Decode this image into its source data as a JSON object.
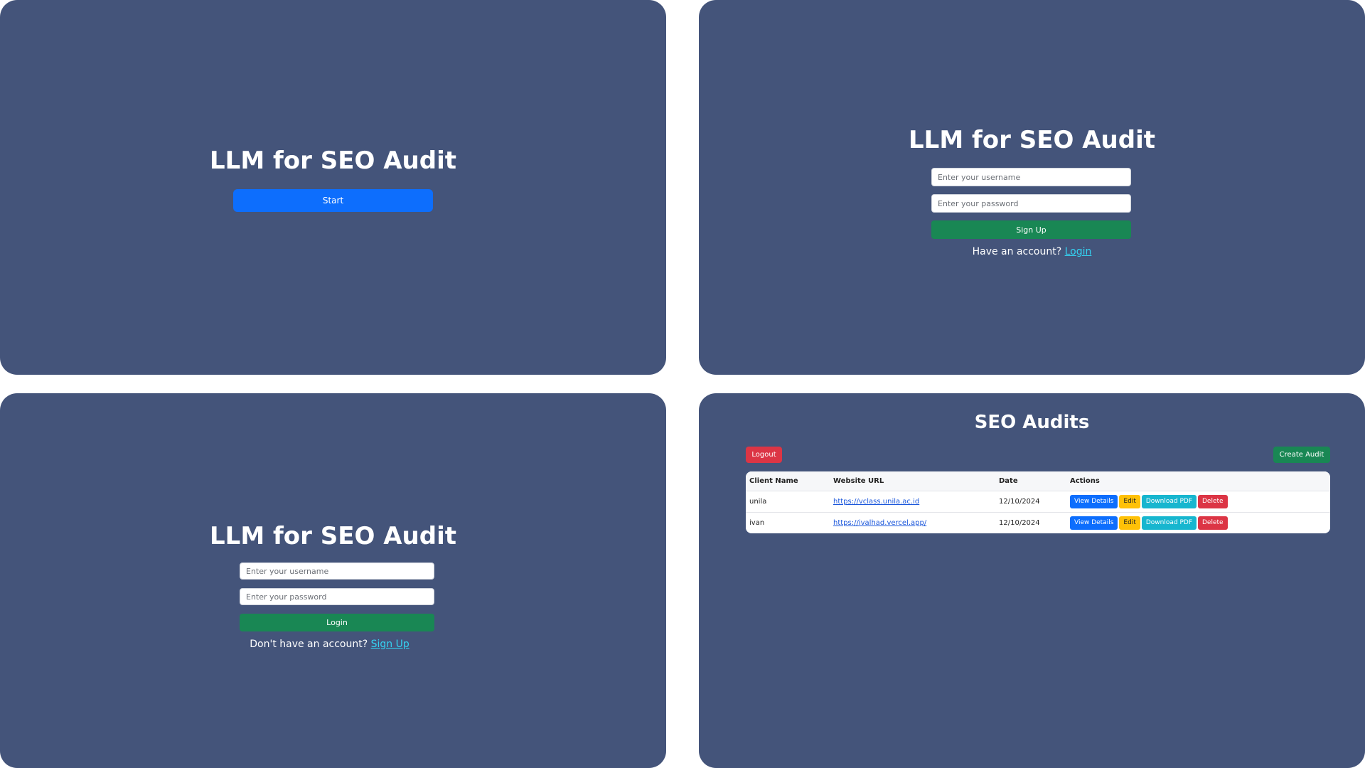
{
  "start_screen": {
    "title": "LLM for SEO Audit",
    "start_label": "Start"
  },
  "signup_screen": {
    "title": "LLM for SEO Audit",
    "username_placeholder": "Enter your username",
    "password_placeholder": "Enter your password",
    "submit_label": "Sign Up",
    "prompt_text": "Have an account?",
    "prompt_link": "Login"
  },
  "login_screen": {
    "title": "LLM for SEO Audit",
    "username_placeholder": "Enter your username",
    "password_placeholder": "Enter your password",
    "submit_label": "Login",
    "prompt_text": "Don't have an account?",
    "prompt_link": "Sign Up"
  },
  "audits_screen": {
    "title": "SEO Audits",
    "logout_label": "Logout",
    "create_label": "Create Audit",
    "columns": [
      "Client Name",
      "Website URL",
      "Date",
      "Actions"
    ],
    "rows": [
      {
        "client": "unila",
        "url": "https://vclass.unila.ac.id",
        "date": "12/10/2024"
      },
      {
        "client": "ivan",
        "url": "https://ivalhad.vercel.app/",
        "date": "12/10/2024"
      }
    ],
    "actions": {
      "view": "View Details",
      "edit": "Edit",
      "pdf": "Download PDF",
      "delete": "Delete"
    }
  },
  "colors": {
    "panel_bg": "#44547a",
    "primary": "#0d6efd",
    "success": "#198754",
    "danger": "#dc3545",
    "warning": "#ffc107",
    "info": "#17b6cf",
    "link": "#34d3f2"
  }
}
